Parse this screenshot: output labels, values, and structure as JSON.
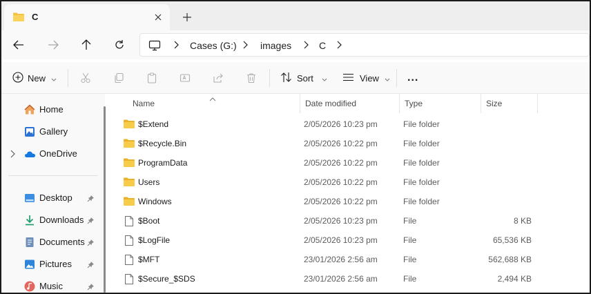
{
  "window": {
    "tab_title": "C",
    "new_tab_symbol": "+"
  },
  "address": {
    "crumbs": [
      "Cases (G:)",
      "images",
      "C"
    ]
  },
  "commands": {
    "new_label": "New",
    "sort_label": "Sort",
    "view_label": "View",
    "more_label": "..."
  },
  "sidebar": {
    "top_items": [
      {
        "label": "Home",
        "icon": "home-icon"
      },
      {
        "label": "Gallery",
        "icon": "gallery-icon"
      },
      {
        "label": "OneDrive",
        "icon": "onedrive-icon"
      }
    ],
    "quick_access": [
      {
        "label": "Desktop",
        "icon": "desktop-icon"
      },
      {
        "label": "Downloads",
        "icon": "downloads-icon"
      },
      {
        "label": "Documents",
        "icon": "documents-icon"
      },
      {
        "label": "Pictures",
        "icon": "pictures-icon"
      },
      {
        "label": "Music",
        "icon": "music-icon"
      }
    ]
  },
  "columns": {
    "name": "Name",
    "date": "Date modified",
    "type": "Type",
    "size": "Size"
  },
  "files": [
    {
      "name": "$Extend",
      "date": "2/05/2026 10:23 pm",
      "type": "File folder",
      "size": "",
      "kind": "folder"
    },
    {
      "name": "$Recycle.Bin",
      "date": "2/05/2026 10:22 pm",
      "type": "File folder",
      "size": "",
      "kind": "folder"
    },
    {
      "name": "ProgramData",
      "date": "2/05/2026 10:22 pm",
      "type": "File folder",
      "size": "",
      "kind": "folder"
    },
    {
      "name": "Users",
      "date": "2/05/2026 10:22 pm",
      "type": "File folder",
      "size": "",
      "kind": "folder"
    },
    {
      "name": "Windows",
      "date": "2/05/2026 10:22 pm",
      "type": "File folder",
      "size": "",
      "kind": "folder"
    },
    {
      "name": "$Boot",
      "date": "2/05/2026 10:23 pm",
      "type": "File",
      "size": "8 KB",
      "kind": "file"
    },
    {
      "name": "$LogFile",
      "date": "2/05/2026 10:23 pm",
      "type": "File",
      "size": "65,536 KB",
      "kind": "file"
    },
    {
      "name": "$MFT",
      "date": "23/01/2026 2:56 am",
      "type": "File",
      "size": "562,688 KB",
      "kind": "file"
    },
    {
      "name": "$Secure_$SDS",
      "date": "23/01/2026 2:56 am",
      "type": "File",
      "size": "2,494 KB",
      "kind": "file"
    }
  ],
  "colors": {
    "folder_yellow": "#f5c342",
    "accent_blue": "#0a64c9",
    "tab_strip_bg": "#eeeeee"
  }
}
